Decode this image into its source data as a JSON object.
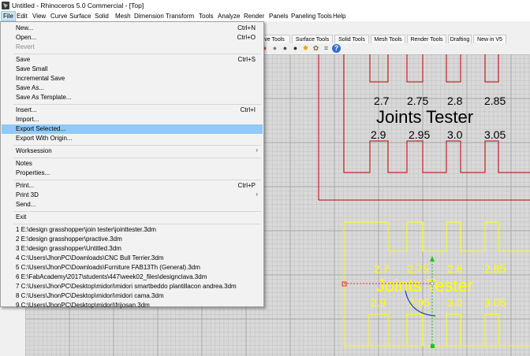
{
  "window": {
    "title": "Untitled - Rhinoceros 5.0 Commercial - [Top]"
  },
  "menubar": [
    "File",
    "Edit",
    "View",
    "Curve",
    "Surface",
    "Solid",
    "Mesh",
    "Dimension",
    "Transform",
    "Tools",
    "Analyze",
    "Render",
    "Panels",
    "Paneling Tools",
    "Help"
  ],
  "toolbar_tabs": [
    "ve Tools",
    "Surface Tools",
    "Solid Tools",
    "Mesh Tools",
    "Render Tools",
    "Drafting",
    "New in V5"
  ],
  "toolbar_icons": [
    "color-wheel-icon",
    "sphere-icon",
    "material-sphere-icon",
    "render-sphere-icon",
    "lightbulb-icon",
    "settings-gear-icon",
    "snap-grid-icon",
    "help-icon"
  ],
  "file_menu": [
    {
      "label": "New...",
      "shortcut": "Ctrl+N"
    },
    {
      "label": "Open...",
      "shortcut": "Ctrl+O"
    },
    {
      "label": "Revert",
      "shortcut": "",
      "disabled": true
    },
    {
      "separator": true
    },
    {
      "label": "Save",
      "shortcut": "Ctrl+S"
    },
    {
      "label": "Save Small",
      "shortcut": ""
    },
    {
      "label": "Incremental Save",
      "shortcut": ""
    },
    {
      "label": "Save As...",
      "shortcut": ""
    },
    {
      "label": "Save As Template...",
      "shortcut": ""
    },
    {
      "separator": true
    },
    {
      "label": "Insert...",
      "shortcut": "Ctrl+I"
    },
    {
      "label": "Import...",
      "shortcut": ""
    },
    {
      "label": "Export Selected...",
      "shortcut": "",
      "highlight": true
    },
    {
      "label": "Export With Origin...",
      "shortcut": ""
    },
    {
      "separator": true
    },
    {
      "label": "Worksession",
      "shortcut": "",
      "submenu": true
    },
    {
      "separator": true
    },
    {
      "label": "Notes",
      "shortcut": ""
    },
    {
      "label": "Properties...",
      "shortcut": ""
    },
    {
      "separator": true
    },
    {
      "label": "Print...",
      "shortcut": "Ctrl+P"
    },
    {
      "label": "Print 3D",
      "shortcut": "",
      "submenu": true
    },
    {
      "label": "Send...",
      "shortcut": ""
    },
    {
      "separator": true
    },
    {
      "label": "Exit",
      "shortcut": ""
    },
    {
      "separator": true
    },
    {
      "label": "1 E:\\design grasshopper\\join tester\\jointtester.3dm",
      "shortcut": ""
    },
    {
      "label": "2 E:\\design grasshopper\\practive.3dm",
      "shortcut": ""
    },
    {
      "label": "3 E:\\design grasshopper\\Untitled.3dm",
      "shortcut": ""
    },
    {
      "label": "4 C:\\Users\\JhonPC\\Downloads\\CNC Bull Terrier.3dm",
      "shortcut": ""
    },
    {
      "label": "5 C:\\Users\\JhonPC\\Downloads\\Furniture FAB13Th (General).3dm",
      "shortcut": ""
    },
    {
      "label": "6 E:\\FabAcademy\\2017\\students\\447\\week02_files\\designclava.3dm",
      "shortcut": ""
    },
    {
      "label": "7 C:\\Users\\JhonPC\\Desktop\\midori\\midori smartbeddo plantillacon andrea.3dm",
      "shortcut": ""
    },
    {
      "label": "8 C:\\Users\\JhonPC\\Desktop\\midori\\midori  cama.3dm",
      "shortcut": ""
    },
    {
      "label": "9 C:\\Users\\JhonPC\\Desktop\\midori\\frijosan.3dm",
      "shortcut": ""
    }
  ],
  "viewport": {
    "joint_widths_top": [
      "2.7",
      "2.75",
      "2.8",
      "2.85"
    ],
    "joint_widths_bottom": [
      "2.9",
      "2.95",
      "3.0",
      "3.05"
    ],
    "object_label": "Joints Tester",
    "colors": {
      "grid": "#c4c4c4",
      "grid_major": "#a8a8a8",
      "reference_object": "#c00000",
      "selected_object": "#ffff00",
      "background": "#d9d9d9"
    }
  }
}
